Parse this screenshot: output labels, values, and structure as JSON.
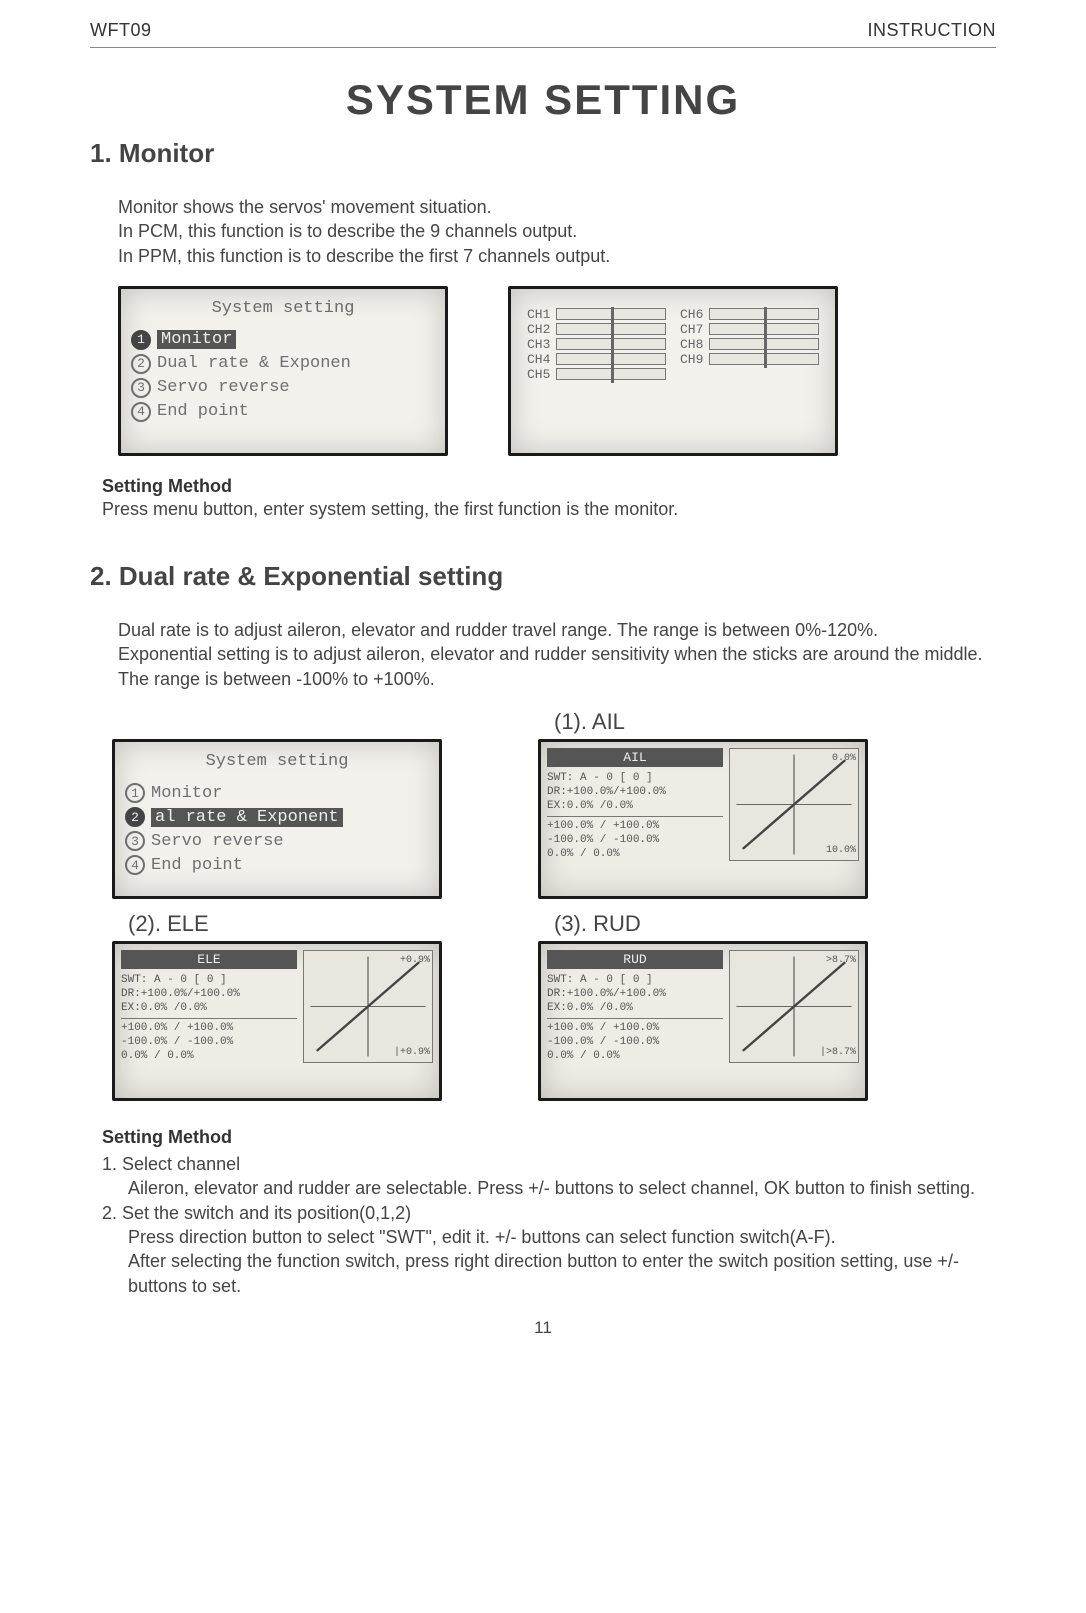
{
  "header": {
    "left": "WFT09",
    "right": "INSTRUCTION"
  },
  "title": "SYSTEM SETTING",
  "section1": {
    "heading": "1. Monitor",
    "p1": "Monitor shows the servos' movement situation.",
    "p2": "In PCM, this function is to describe the 9 channels output.",
    "p3": "In PPM, this function is to describe the first 7 channels output.",
    "lcd_menu_title": "System setting",
    "menu": [
      {
        "n": "1",
        "t": "Monitor"
      },
      {
        "n": "2",
        "t": "Dual rate & Exponen"
      },
      {
        "n": "3",
        "t": "Servo reverse"
      },
      {
        "n": "4",
        "t": "End point"
      }
    ],
    "channels_left": [
      "CH1",
      "CH2",
      "CH3",
      "CH4",
      "CH5"
    ],
    "channels_right": [
      "CH6",
      "CH7",
      "CH8",
      "CH9"
    ],
    "method_h": "Setting Method",
    "method_p": "Press menu button, enter system setting, the first function is the monitor."
  },
  "section2": {
    "heading": "2. Dual rate & Exponential setting",
    "p1": "Dual rate is to adjust aileron, elevator and rudder travel range. The range is between 0%-120%.",
    "p2": "Exponential setting is to adjust aileron, elevator and rudder sensitivity when the sticks are around the middle. The range is between -100% to +100%.",
    "labels": {
      "ail": "(1). AIL",
      "ele": "(2). ELE",
      "rud": "(3). RUD"
    },
    "lcd_menu_title": "System setting",
    "menu2": [
      {
        "n": "1",
        "t": "Monitor"
      },
      {
        "n": "2",
        "t": "al rate & Exponent"
      },
      {
        "n": "3",
        "t": "Servo reverse"
      },
      {
        "n": "4",
        "t": "End point"
      }
    ],
    "dr": {
      "ail": {
        "tab": "AIL",
        "swt": "SWT: A - 0    [ 0 ]",
        "dr": "DR:+100.0%/+100.0%",
        "ex": "EX:0.0%   /0.0%",
        "b1": "+100.0% / +100.0%",
        "b2": "-100.0% / -100.0%",
        "b3": "0.0%    / 0.0%",
        "g1": "0.0%",
        "g2": "10.0%"
      },
      "ele": {
        "tab": "ELE",
        "swt": "SWT: A - 0    [ 0 ]",
        "dr": "DR:+100.0%/+100.0%",
        "ex": "EX:0.0%   /0.0%",
        "b1": "+100.0% / +100.0%",
        "b2": "-100.0% / -100.0%",
        "b3": "0.0%    / 0.0%",
        "g1": "+0.9%",
        "g2": "|+0.9%"
      },
      "rud": {
        "tab": "RUD",
        "swt": "SWT: A - 0    [ 0 ]",
        "dr": "DR:+100.0%/+100.0%",
        "ex": "EX:0.0%   /0.0%",
        "b1": "+100.0% / +100.0%",
        "b2": "-100.0% / -100.0%",
        "b3": "0.0%    / 0.0%",
        "g1": ">8.7%",
        "g2": "|>8.7%"
      }
    },
    "method_h": "Setting Method",
    "m1": "1. Select channel",
    "m1a": "Aileron, elevator and rudder are selectable. Press +/- buttons to select channel, OK button to finish setting.",
    "m2": "2. Set the switch and its position(0,1,2)",
    "m2a": "Press direction button to select \"SWT\", edit it. +/- buttons can select function switch(A-F).",
    "m2b": "After selecting the function switch, press right direction button to enter the switch position setting, use +/- buttons to set."
  },
  "page": "11"
}
